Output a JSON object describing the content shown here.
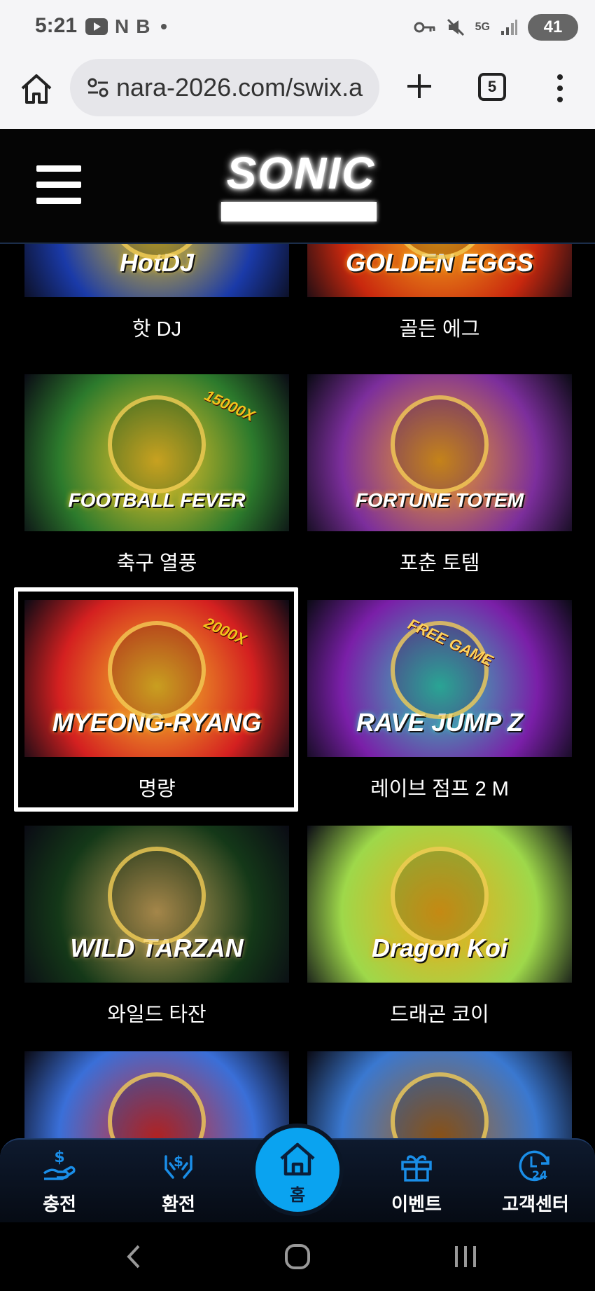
{
  "status_bar": {
    "time": "5:21",
    "left_glyphs": [
      "N",
      "B"
    ],
    "battery": "41",
    "network": "5G"
  },
  "browser": {
    "url": "nara-2026.com/swix.a",
    "tab_count": "5"
  },
  "site": {
    "logo_text": "SONIC"
  },
  "games": [
    {
      "title": "핫 DJ",
      "art": "HotDJ",
      "colors": [
        "#1a3aa8",
        "#e8c21a"
      ]
    },
    {
      "title": "골든 에그",
      "art": "GOLDEN EGGS",
      "colors": [
        "#c9280e",
        "#f7b11b"
      ]
    },
    {
      "title": "축구 열풍",
      "art": "FOOTBALL FEVER",
      "colors": [
        "#2c7a2c",
        "#f4c528"
      ]
    },
    {
      "title": "포춘 토템",
      "art": "FORTUNE TOTEM",
      "colors": [
        "#7c2e9c",
        "#f0a020"
      ]
    },
    {
      "title": "명량",
      "art": "MYEONG-RYANG",
      "colors": [
        "#d42020",
        "#f5c228"
      ]
    },
    {
      "title": "레이브 점프 2 M",
      "art": "RAVE JUMP Z",
      "colors": [
        "#7a1fa8",
        "#33c9b5"
      ]
    },
    {
      "title": "와일드 타잔",
      "art": "WILD TARZAN",
      "colors": [
        "#143818",
        "#c9a45a"
      ]
    },
    {
      "title": "드래곤 코이",
      "art": "Dragon Koi",
      "colors": [
        "#9ed84a",
        "#f0a818"
      ]
    },
    {
      "title": "",
      "art": "",
      "colors": [
        "#3a6fd8",
        "#d82a2a"
      ]
    },
    {
      "title": "",
      "art": "",
      "colors": [
        "#3a78d0",
        "#a8641c"
      ]
    }
  ],
  "game_badges": {
    "football": "15000X",
    "myeong": "2000X",
    "rave": "FREE GAME"
  },
  "bottom_nav": {
    "charge": "충전",
    "exchange": "환전",
    "home": "홈",
    "event": "이벤트",
    "support": "고객센터"
  }
}
